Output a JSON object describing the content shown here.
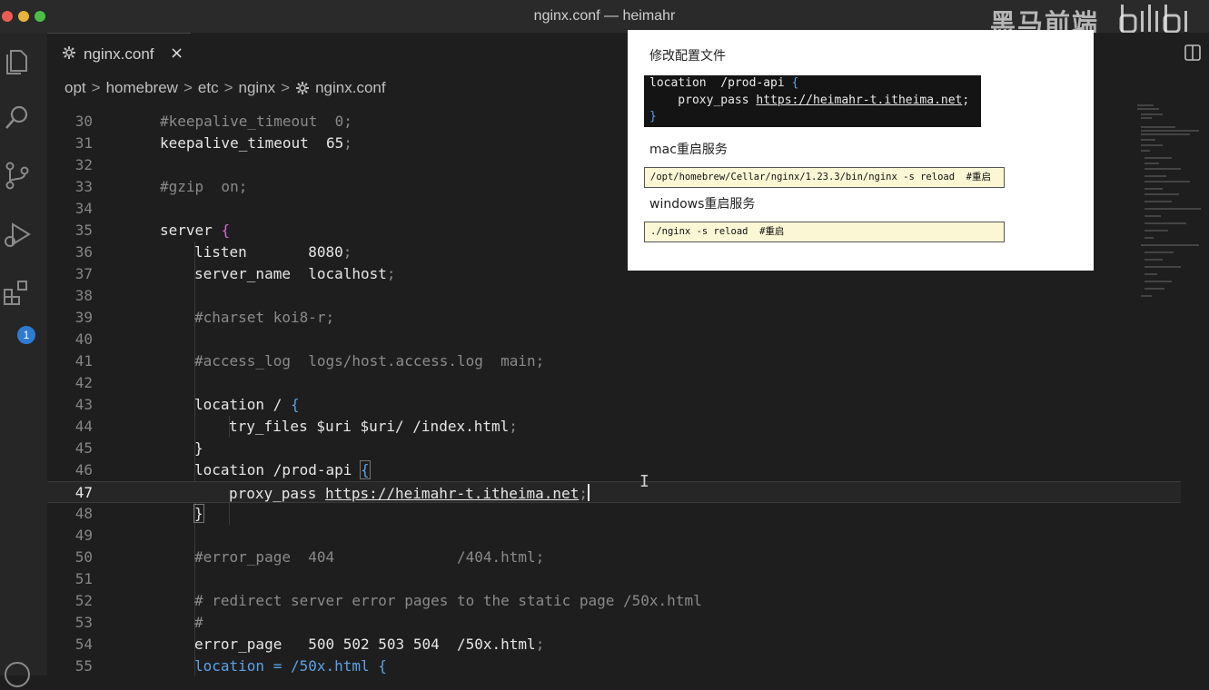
{
  "window": {
    "title": "nginx.conf — heimahr"
  },
  "watermark": {
    "channel": "黑马前端",
    "logo": "Bilibili"
  },
  "tab": {
    "label": "nginx.conf",
    "close": "×"
  },
  "activity_bar": {
    "extensions_badge": "1"
  },
  "breadcrumb": [
    "opt",
    "homebrew",
    "etc",
    "nginx",
    "nginx.conf"
  ],
  "breadcrumb_sep": ">",
  "editor": {
    "current_line": "47",
    "lines": [
      {
        "n": "30",
        "text": "#keepalive_timeout  0;"
      },
      {
        "n": "31",
        "text": "keepalive_timeout  65"
      },
      {
        "n": "32",
        "text": ""
      },
      {
        "n": "33",
        "text": "#gzip  on;"
      },
      {
        "n": "34",
        "text": ""
      },
      {
        "n": "35",
        "text": "server"
      },
      {
        "n": "36",
        "text": "listen       8080"
      },
      {
        "n": "37",
        "text": "server_name  localhost"
      },
      {
        "n": "38",
        "text": ""
      },
      {
        "n": "39",
        "text": "#charset koi8-r;"
      },
      {
        "n": "40",
        "text": ""
      },
      {
        "n": "41",
        "text": "#access_log  logs/host.access.log  main;"
      },
      {
        "n": "42",
        "text": ""
      },
      {
        "n": "43",
        "text": "location / "
      },
      {
        "n": "44",
        "text": "try_files $uri $uri/ /index.html"
      },
      {
        "n": "45",
        "text": "}"
      },
      {
        "n": "46",
        "text": "location /prod-api "
      },
      {
        "n": "47",
        "text": "proxy_pass ",
        "url": "https://heimahr-t.itheima.net"
      },
      {
        "n": "48",
        "text": "}"
      },
      {
        "n": "49",
        "text": ""
      },
      {
        "n": "50",
        "text": "#error_page  404              /404.html;"
      },
      {
        "n": "51",
        "text": ""
      },
      {
        "n": "52",
        "text": "# redirect server error pages to the static page /50x.html"
      },
      {
        "n": "53",
        "text": "#"
      },
      {
        "n": "54",
        "text": "error_page   500 502 503 504  /50x.html"
      },
      {
        "n": "55",
        "text": "location = /50x.html "
      }
    ]
  },
  "slide": {
    "heading1": "修改配置文件",
    "code": {
      "line1": "location  /prod-api ",
      "line2_prefix": "    proxy_pass ",
      "line2_url": "https://heimahr-t.itheima.net",
      "line3": "}"
    },
    "heading2": "mac重启服务",
    "mac_cmd": "/opt/homebrew/Cellar/nginx/1.23.3/bin/nginx -s reload  #重启",
    "heading3": "windows重启服务",
    "win_cmd": "./nginx -s reload  #重启"
  },
  "colors": {
    "editor_bg": "#1e1e1e",
    "comment": "#8a8a8a",
    "bracket": "#5aa2e6",
    "badge": "#2f7bd1"
  }
}
